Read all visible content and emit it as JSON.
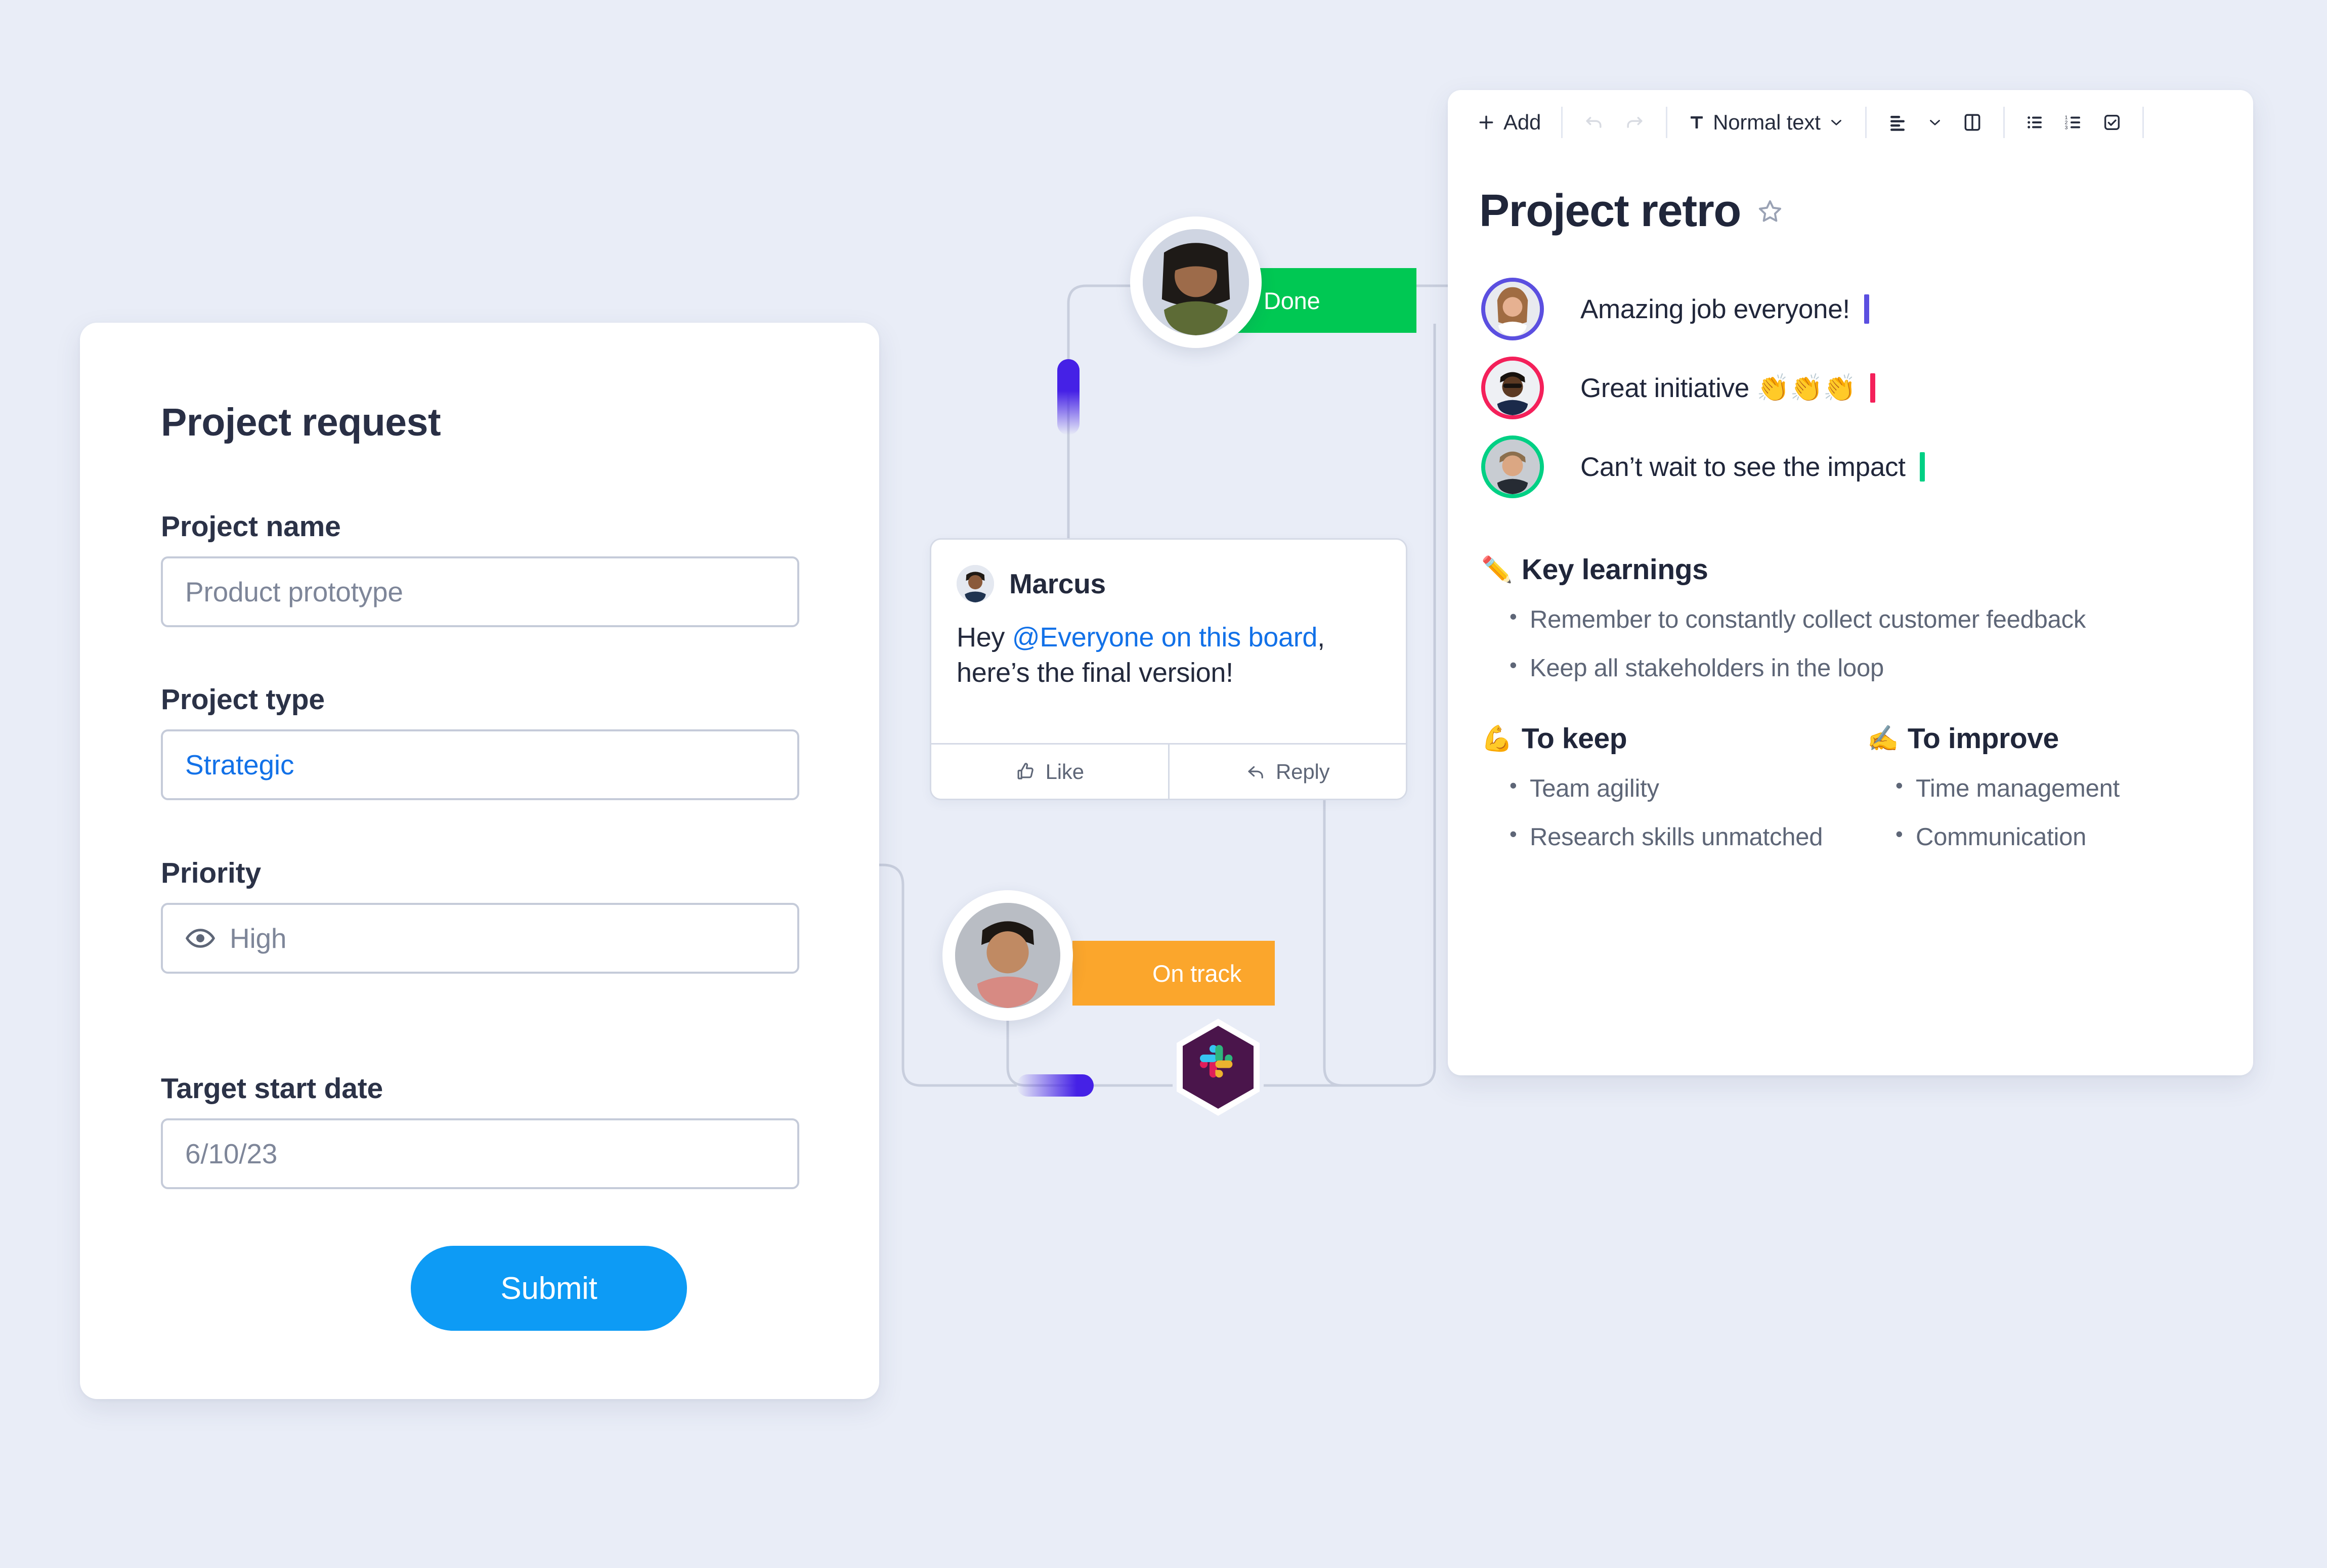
{
  "theme": {
    "background": "#e9edf7",
    "accent_blue": "#0d9bf5",
    "link_blue": "#1271e8",
    "green": "#00c853",
    "orange": "#fba62c",
    "purple": "#4521e6",
    "slack_purple": "#4a154b"
  },
  "form": {
    "title": "Project request",
    "fields": [
      {
        "label": "Project name",
        "value": "Product prototype",
        "placeholder": "Product prototype",
        "icon": ""
      },
      {
        "label": "Project type",
        "value": "Strategic",
        "placeholder": "Strategic",
        "icon": ""
      },
      {
        "label": "Priority",
        "value": "High",
        "placeholder": "High",
        "icon": "eye-icon"
      },
      {
        "label": "Target start date",
        "value": "6/10/23",
        "placeholder": "6/10/23",
        "icon": ""
      }
    ],
    "submit_label": "Submit"
  },
  "comment_card": {
    "author": "Marcus",
    "text_prefix": "Hey ",
    "mention": "@Everyone on this board",
    "text_suffix": ",",
    "text_line2": "here’s the final version!",
    "like_label": "Like",
    "reply_label": "Reply"
  },
  "status_chips": {
    "done": {
      "label": "Done",
      "color": "#00c853"
    },
    "on_track": {
      "label": "On track",
      "color": "#fba62c"
    }
  },
  "doc": {
    "toolbar": {
      "add_label": "Add",
      "undo_label": "undo-icon",
      "redo_label": "redo-icon",
      "text_style": "Normal text",
      "align_label": "align-left-icon",
      "columns_label": "columns-icon",
      "bullet_list_label": "bullet-list-icon",
      "numbered_list_label": "numbered-list-icon",
      "checklist_label": "checklist-icon"
    },
    "title": "Project retro",
    "star_icon": "star-icon",
    "comments": [
      {
        "text": "Amazing job everyone!",
        "ring_color": "#5b4fe0",
        "caret_color": "#5b4fe0"
      },
      {
        "text": "Great initiative 👏👏👏",
        "ring_color": "#f4205a",
        "caret_color": "#f4205a"
      },
      {
        "text": "Can’t wait to see the impact",
        "ring_color": "#00d084",
        "caret_color": "#00d084"
      }
    ],
    "sections": [
      {
        "emoji": "✏️",
        "heading": "Key learnings",
        "items": [
          "Remember to constantly collect customer feedback",
          "Keep all stakeholders in the loop"
        ]
      },
      {
        "emoji": "💪",
        "heading": "To keep",
        "items": [
          "Team agility",
          "Research skills unmatched"
        ]
      },
      {
        "emoji": "✍️",
        "heading": "To improve",
        "items": [
          "Time management",
          "Communication"
        ]
      }
    ]
  }
}
